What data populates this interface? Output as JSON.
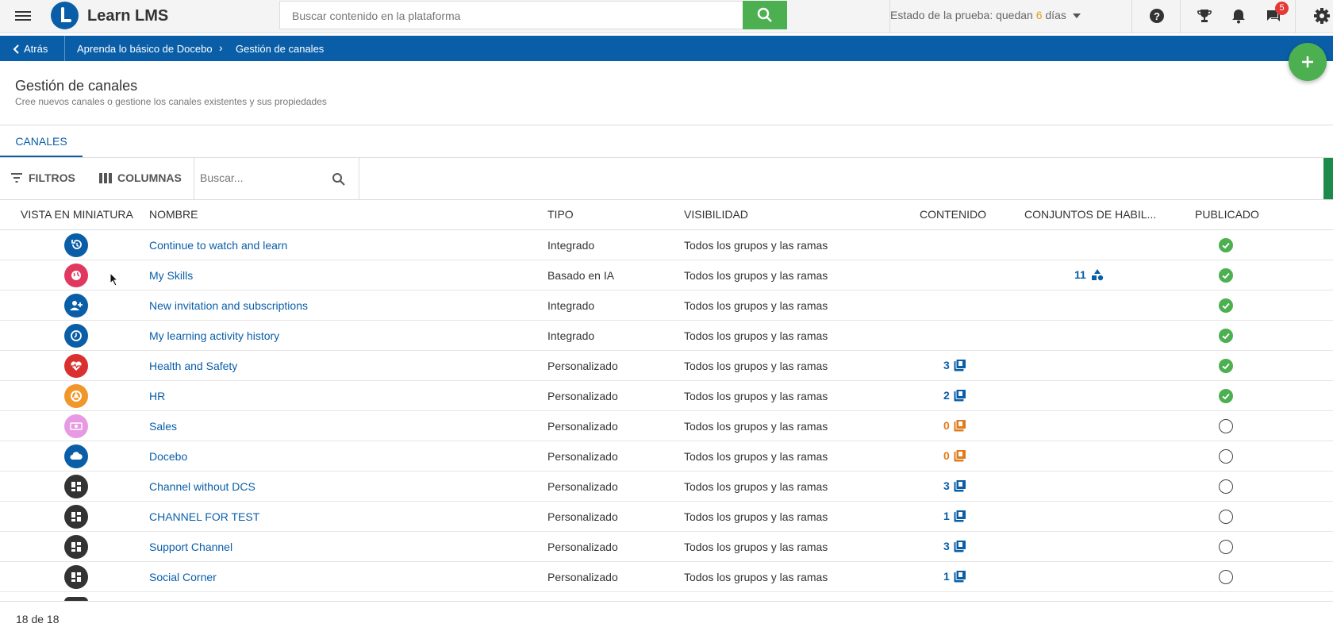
{
  "app": {
    "brand": "Learn LMS"
  },
  "header": {
    "search_placeholder": "Buscar contenido en la plataforma",
    "trial_prefix": "Estado de la prueba: quedan ",
    "trial_days": "6",
    "trial_suffix": " días",
    "messages_badge": "5"
  },
  "breadcrumb": {
    "back_label": "Atrás",
    "parent": "Aprenda lo básico de Docebo",
    "current": "Gestión de canales"
  },
  "page": {
    "title": "Gestión de canales",
    "subtitle": "Cree nuevos canales o gestione los canales existentes y sus propiedades",
    "tab": "CANALES"
  },
  "toolbar": {
    "filters_label": "FILTROS",
    "columns_label": "COLUMNAS",
    "search_placeholder": "Buscar..."
  },
  "table": {
    "headers": {
      "thumb": "VISTA EN MINIATURA",
      "name": "NOMBRE",
      "type": "TIPO",
      "visibility": "VISIBILIDAD",
      "content": "CONTENIDO",
      "skills": "CONJUNTOS DE HABIL...",
      "published": "PUBLICADO"
    },
    "rows": [
      {
        "name": "Continue to watch and learn",
        "type": "Integrado",
        "visibility": "Todos los grupos y las ramas",
        "content": "",
        "skills": "",
        "published": true,
        "icon": "history-icon",
        "color": "#0a5ea8"
      },
      {
        "name": "My Skills",
        "type": "Basado en IA",
        "visibility": "Todos los grupos y las ramas",
        "content": "",
        "skills": "11",
        "published": true,
        "icon": "globe-icon",
        "color": "#e0385e"
      },
      {
        "name": "New invitation and subscriptions",
        "type": "Integrado",
        "visibility": "Todos los grupos y las ramas",
        "content": "",
        "skills": "",
        "published": true,
        "icon": "user-add-icon",
        "color": "#0a5ea8"
      },
      {
        "name": "My learning activity history",
        "type": "Integrado",
        "visibility": "Todos los grupos y las ramas",
        "content": "",
        "skills": "",
        "published": true,
        "icon": "clock-icon",
        "color": "#0a5ea8"
      },
      {
        "name": "Health and Safety",
        "type": "Personalizado",
        "visibility": "Todos los grupos y las ramas",
        "content": "3",
        "skills": "",
        "published": true,
        "icon": "heartbeat-icon",
        "color": "#d93030"
      },
      {
        "name": "HR",
        "type": "Personalizado",
        "visibility": "Todos los grupos y las ramas",
        "content": "2",
        "skills": "",
        "published": true,
        "icon": "chrome-icon",
        "color": "#f0962a"
      },
      {
        "name": "Sales",
        "type": "Personalizado",
        "visibility": "Todos los grupos y las ramas",
        "content": "0",
        "skills": "",
        "published": false,
        "icon": "money-icon",
        "color": "#e79ae3"
      },
      {
        "name": "Docebo",
        "type": "Personalizado",
        "visibility": "Todos los grupos y las ramas",
        "content": "0",
        "skills": "",
        "published": false,
        "icon": "cloud-icon",
        "color": "#0a5ea8"
      },
      {
        "name": "Channel without DCS",
        "type": "Personalizado",
        "visibility": "Todos los grupos y las ramas",
        "content": "3",
        "skills": "",
        "published": false,
        "icon": "dashboard-icon",
        "color": "#333333"
      },
      {
        "name": "CHANNEL FOR TEST",
        "type": "Personalizado",
        "visibility": "Todos los grupos y las ramas",
        "content": "1",
        "skills": "",
        "published": false,
        "icon": "dashboard-icon",
        "color": "#333333"
      },
      {
        "name": "Support Channel",
        "type": "Personalizado",
        "visibility": "Todos los grupos y las ramas",
        "content": "3",
        "skills": "",
        "published": false,
        "icon": "dashboard-icon",
        "color": "#333333"
      },
      {
        "name": "Social Corner",
        "type": "Personalizado",
        "visibility": "Todos los grupos y las ramas",
        "content": "1",
        "skills": "",
        "published": false,
        "icon": "dashboard-icon",
        "color": "#333333"
      }
    ]
  },
  "colors": {
    "content_link": "#0a5ea8",
    "content_zero": "#e07b1c"
  },
  "footer": {
    "count": "18 de 18"
  }
}
